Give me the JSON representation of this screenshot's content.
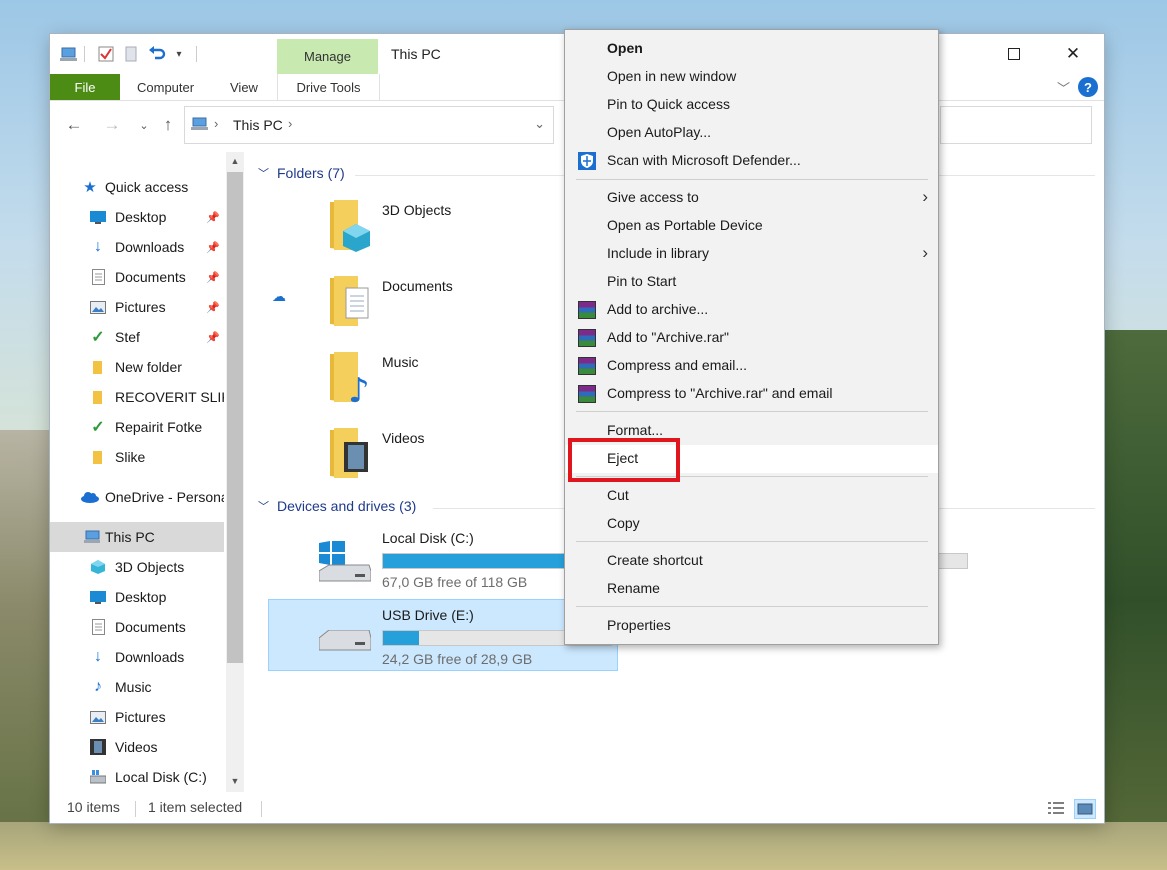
{
  "window": {
    "title": "This PC",
    "quick_access_toolbar": [
      "computer-icon",
      "checkmark-properties-icon",
      "new-folder-icon",
      "undo-icon",
      "customize-dropdown-icon"
    ]
  },
  "ribbon": {
    "contextual_group_label": "Manage",
    "tabs": [
      "File",
      "Computer",
      "View",
      "Drive Tools"
    ]
  },
  "address_bar": {
    "path": "This PC"
  },
  "navigation_pane": {
    "items": [
      {
        "label": "Quick access",
        "icon": "star-icon",
        "pinned": false
      },
      {
        "label": "Desktop",
        "icon": "desktop-icon",
        "pinned": true
      },
      {
        "label": "Downloads",
        "icon": "download-icon",
        "pinned": true
      },
      {
        "label": "Documents",
        "icon": "document-icon",
        "pinned": true
      },
      {
        "label": "Pictures",
        "icon": "pictures-icon",
        "pinned": true
      },
      {
        "label": "Stef",
        "icon": "checkmark-icon",
        "pinned": true
      },
      {
        "label": "New folder",
        "icon": "folder-icon",
        "pinned": false
      },
      {
        "label": "RECOVERIT SLIKE",
        "icon": "folder-icon",
        "pinned": false
      },
      {
        "label": "Repairit Fotke",
        "icon": "checkmark-icon",
        "pinned": false
      },
      {
        "label": "Slike",
        "icon": "folder-icon",
        "pinned": false
      },
      {
        "label": "OneDrive - Personal",
        "icon": "cloud-icon",
        "pinned": false
      },
      {
        "label": "This PC",
        "icon": "computer-icon",
        "pinned": false
      },
      {
        "label": "3D Objects",
        "icon": "cube-icon",
        "pinned": false
      },
      {
        "label": "Desktop",
        "icon": "desktop-icon",
        "pinned": false
      },
      {
        "label": "Documents",
        "icon": "document-icon",
        "pinned": false
      },
      {
        "label": "Downloads",
        "icon": "download-icon",
        "pinned": false
      },
      {
        "label": "Music",
        "icon": "music-note-icon",
        "pinned": false
      },
      {
        "label": "Pictures",
        "icon": "pictures-icon",
        "pinned": false
      },
      {
        "label": "Videos",
        "icon": "film-icon",
        "pinned": false
      },
      {
        "label": "Local Disk (C:)",
        "icon": "drive-icon",
        "pinned": false
      }
    ]
  },
  "content": {
    "folders_header": "Folders (7)",
    "folders": [
      {
        "label": "3D Objects",
        "icon": "folder-3d-objects-icon"
      },
      {
        "label": "Documents",
        "icon": "folder-documents-icon",
        "cloud": true
      },
      {
        "label": "Music",
        "icon": "folder-music-icon"
      },
      {
        "label": "Videos",
        "icon": "folder-videos-icon"
      }
    ],
    "drives_header": "Devices and drives (3)",
    "drives": [
      {
        "name": "Local Disk (C:)",
        "free_text": "67,0 GB free of 118 GB",
        "used_fraction": 0.43,
        "icon": "windows-drive-icon",
        "selected": false
      },
      {
        "name": "USB Drive (E:)",
        "free_text": "24,2 GB free of 28,9 GB",
        "used_fraction": 0.16,
        "icon": "usb-drive-icon",
        "selected": true
      }
    ]
  },
  "status_bar": {
    "item_count": "10 items",
    "selection": "1 item selected"
  },
  "context_menu": {
    "items": [
      {
        "label": "Open",
        "bold": true
      },
      {
        "label": "Open in new window"
      },
      {
        "label": "Pin to Quick access"
      },
      {
        "label": "Open AutoPlay..."
      },
      {
        "label": "Scan with Microsoft Defender...",
        "icon": "defender-shield-icon"
      },
      {
        "label": "Give access to",
        "submenu": true
      },
      {
        "label": "Open as Portable Device"
      },
      {
        "label": "Include in library",
        "submenu": true
      },
      {
        "label": "Pin to Start"
      },
      {
        "label": "Add to archive...",
        "icon": "winrar-icon"
      },
      {
        "label": "Add to \"Archive.rar\"",
        "icon": "winrar-icon"
      },
      {
        "label": "Compress and email...",
        "icon": "winrar-icon"
      },
      {
        "label": "Compress to \"Archive.rar\" and email",
        "icon": "winrar-icon"
      },
      {
        "label": "Format..."
      },
      {
        "label": "Eject",
        "hovered": true
      },
      {
        "label": "Cut"
      },
      {
        "label": "Copy"
      },
      {
        "label": "Create shortcut"
      },
      {
        "label": "Rename"
      },
      {
        "label": "Properties"
      }
    ]
  },
  "colors": {
    "file_tab": "#4c8b14",
    "manage_tab": "#c8e9b0",
    "selection": "#cce8ff",
    "progress": "#26a0da",
    "eject_highlight": "#e0161e",
    "group_header": "#1e3a8a"
  }
}
